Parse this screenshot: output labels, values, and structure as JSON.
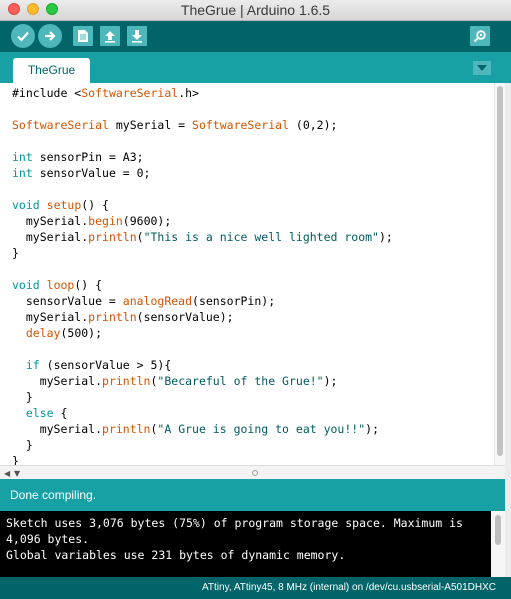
{
  "window": {
    "title": "TheGrue | Arduino 1.6.5"
  },
  "toolbar": {
    "verify_icon": "checkmark-icon",
    "upload_icon": "arrow-right-icon",
    "new_icon": "document-icon",
    "open_icon": "arrow-up-icon",
    "save_icon": "arrow-down-icon",
    "serial_monitor_icon": "magnifier-icon"
  },
  "tabs": {
    "active_label": "TheGrue",
    "menu_icon": "triangle-down-icon"
  },
  "editor": {
    "lines": [
      "#include <SoftwareSerial.h>",
      "",
      "SoftwareSerial mySerial = SoftwareSerial (0,2);",
      "",
      "int sensorPin = A3;",
      "int sensorValue = 0;",
      "",
      "void setup() {",
      "  mySerial.begin(9600);",
      "  mySerial.println(\"This is a nice well lighted room\");",
      "}",
      "",
      "void loop() {",
      "  sensorValue = analogRead(sensorPin);",
      "  mySerial.println(sensorValue);",
      "  delay(500);",
      "",
      "  if (sensorValue > 5){",
      "    mySerial.println(\"Becareful of the Grue!\");",
      "  }",
      "  else {",
      "    mySerial.println(\"A Grue is going to eat you!!\");",
      "  }",
      "}"
    ]
  },
  "status": {
    "message": "Done compiling."
  },
  "console": {
    "lines": [
      "Sketch uses 3,076 bytes (75%) of program storage space. Maximum is",
      "4,096 bytes.",
      "Global variables use 231 bytes of dynamic memory."
    ]
  },
  "board_info": "ATtiny, ATtiny45, 8 MHz (internal) on /dev/cu.usbserial-A501DHXC",
  "colors": {
    "toolbar": "#006468",
    "tabbar": "#17a1a5",
    "button": "#4db7bb",
    "keyword": "#00979c",
    "function": "#d35400",
    "string": "#005c5f"
  }
}
